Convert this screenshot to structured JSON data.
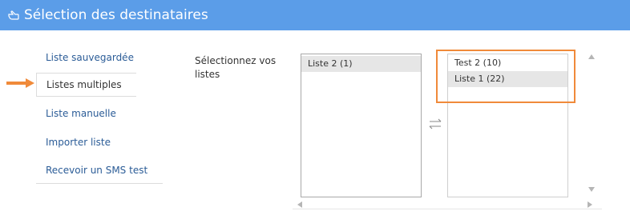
{
  "header": {
    "icon": "pointing-hand-icon",
    "title": "Sélection des destinataires",
    "background_color": "#5b9de8"
  },
  "menu": {
    "items": [
      {
        "label": "Liste sauvegardée"
      },
      {
        "label": "Listes multiples",
        "active": true
      },
      {
        "label": "Liste manuelle"
      },
      {
        "label": "Importer liste"
      },
      {
        "label": "Recevoir un SMS test"
      }
    ],
    "link_color": "#2b5c97",
    "pointer_icon": "right-arrow-icon",
    "pointer_color": "#f08a3a"
  },
  "selection": {
    "label": "Sélectionnez vos listes"
  },
  "available_lists": [
    {
      "label": "Liste 2 (1)",
      "selected": true
    }
  ],
  "chosen_lists": [
    {
      "label": "Test 2 (10)",
      "selected": false
    },
    {
      "label": "Liste 1 (22)",
      "selected": true
    }
  ],
  "transfer_icon": "swap-arrows-icon",
  "highlight_color": "#f08a3a"
}
